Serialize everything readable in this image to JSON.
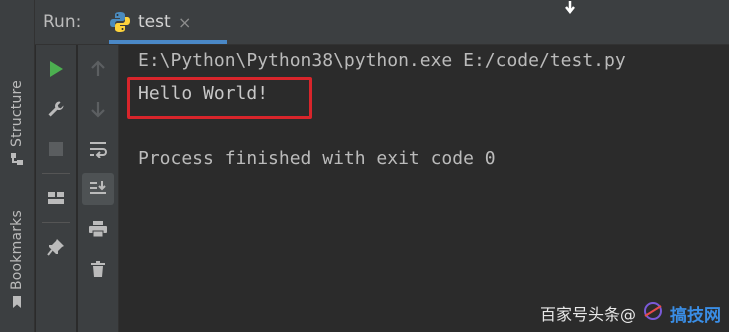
{
  "sidebar": {
    "structure_label": "Structure",
    "bookmarks_label": "Bookmarks"
  },
  "header": {
    "run_label": "Run:",
    "tab_title": "test",
    "tab_close": "×"
  },
  "console": {
    "lines": [
      "E:\\Python\\Python38\\python.exe E:/code/test.py",
      "Hello World!",
      "Process finished with exit code 0"
    ]
  },
  "watermark": {
    "text": "百家号头条@",
    "brand": "搞技网"
  },
  "colors": {
    "highlight_border": "#d8252b",
    "tab_underline": "#4a88c7",
    "run_green": "#4caf50"
  }
}
